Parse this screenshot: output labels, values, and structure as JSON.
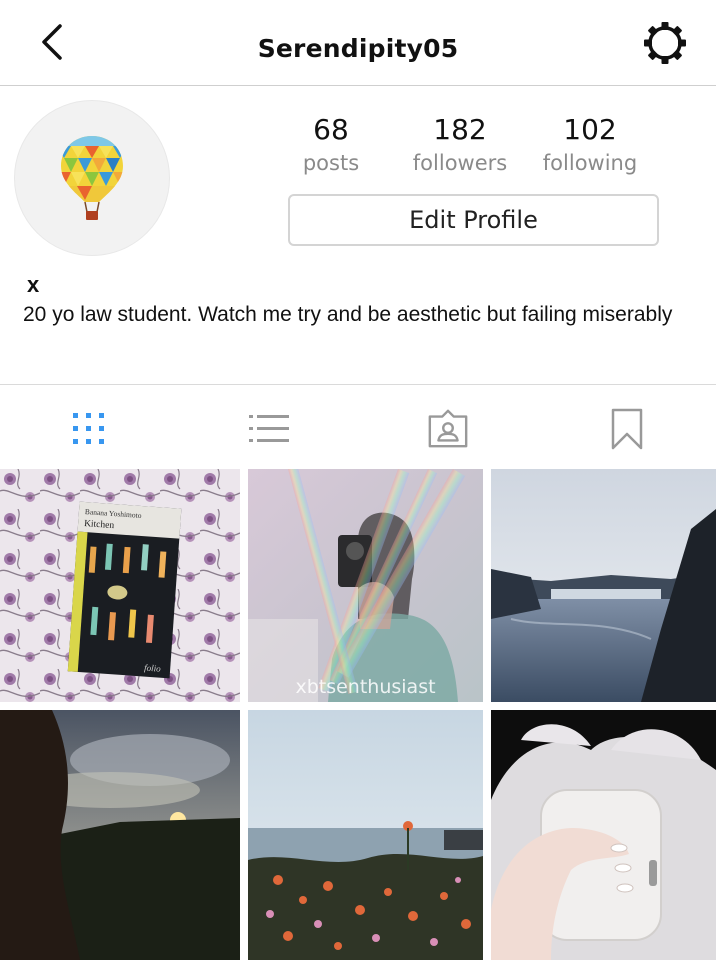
{
  "header": {
    "title": "Serendipity05",
    "back_icon": "chevron-left-icon",
    "settings_icon": "gear-icon"
  },
  "profile": {
    "avatar_icon": "hot-air-balloon-icon",
    "stats": [
      {
        "value": "68",
        "label": "posts"
      },
      {
        "value": "182",
        "label": "followers"
      },
      {
        "value": "102",
        "label": "following"
      }
    ],
    "edit_label": "Edit Profile",
    "name": "x",
    "bio": "20 yo law student. Watch me try and be aesthetic but failing miserably"
  },
  "tabs": [
    {
      "icon": "grid-icon",
      "active": true
    },
    {
      "icon": "list-icon",
      "active": false
    },
    {
      "icon": "tagged-person-icon",
      "active": false
    },
    {
      "icon": "bookmark-icon",
      "active": false
    }
  ],
  "colors": {
    "active_tab": "#3897f0",
    "inactive_tab": "#999999",
    "muted_text": "#8a8a8a"
  },
  "posts": [
    {
      "kind": "book-on-floral-fabric",
      "book_author": "Banana Yoshimoto",
      "book_title": "Kitchen",
      "publisher": "folio"
    },
    {
      "kind": "mirror-selfie-rainbow",
      "watermark": "xbtsenthusiast"
    },
    {
      "kind": "waterfall-landscape"
    },
    {
      "kind": "sunset-silhouette"
    },
    {
      "kind": "flowers-by-sea"
    },
    {
      "kind": "white-clutch-bag"
    }
  ]
}
